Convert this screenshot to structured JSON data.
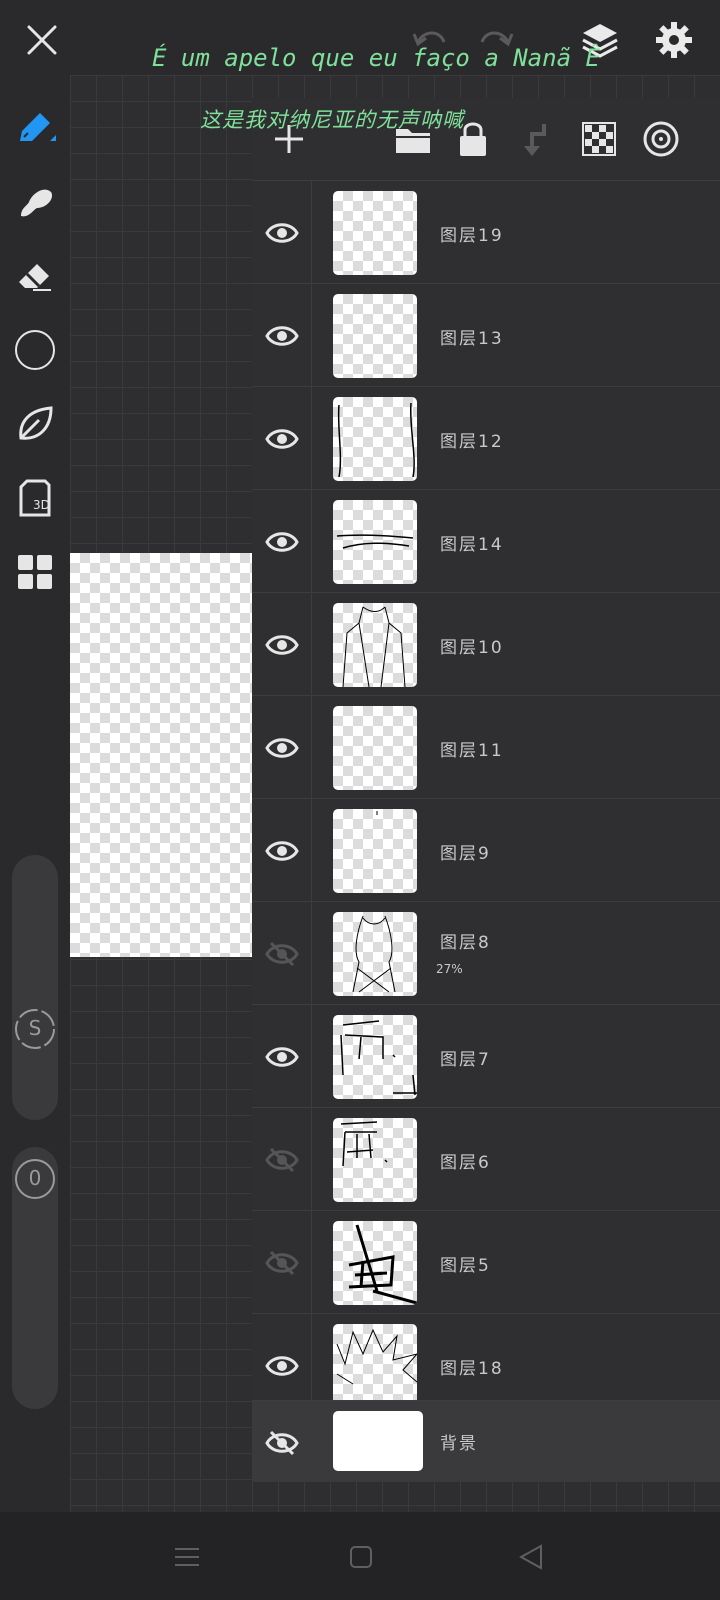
{
  "overlay": {
    "line1": "É um apelo que eu faço a Nanã Ê",
    "line2": "这是我对纳尼亚的无声呐喊"
  },
  "topbar": {
    "close_icon": "close-icon",
    "undo_icon": "undo-icon",
    "redo_icon": "redo-icon",
    "layers_icon": "layers-icon",
    "settings_icon": "gear-icon"
  },
  "tools": [
    "pen-tool",
    "smudge-tool",
    "eraser-tool",
    "color-picker",
    "leaf-brush",
    "3d-tool",
    "grid-menu"
  ],
  "sliders": {
    "size_label": "S",
    "opacity_label": "0"
  },
  "layers": [
    {
      "name": "图层19",
      "visible": true
    },
    {
      "name": "图层13",
      "visible": true
    },
    {
      "name": "图层12",
      "visible": true
    },
    {
      "name": "图层14",
      "visible": true
    },
    {
      "name": "图层10",
      "visible": true
    },
    {
      "name": "图层11",
      "visible": true
    },
    {
      "name": "图层9",
      "visible": true
    },
    {
      "name": "图层8",
      "visible": false,
      "opacity": "27%"
    },
    {
      "name": "图层7",
      "visible": true
    },
    {
      "name": "图层6",
      "visible": false
    },
    {
      "name": "图层5",
      "visible": false
    },
    {
      "name": "图层18",
      "visible": true
    }
  ],
  "background_layer": {
    "name": "背景",
    "visible": false
  },
  "colors": {
    "accent": "#2196f3",
    "overlay_text": "#7fe09a"
  }
}
